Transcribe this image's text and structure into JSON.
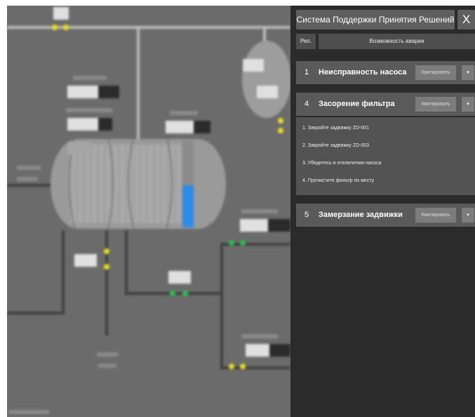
{
  "panel": {
    "title": "Система Поддержки Принятия Решений",
    "close_label": "X",
    "col_rel": "Рел.",
    "col_possibility": "Возможность аварии"
  },
  "alarms": [
    {
      "num": "1",
      "title": "Неисправность насоса",
      "ack_label": "Квитировать",
      "expanded": false
    },
    {
      "num": "4",
      "title": "Засорение фильтра",
      "ack_label": "Квитировать",
      "expanded": true,
      "steps": [
        "1. Закройте задвижку ZD-001",
        "2. Закройте задвижку ZD-003",
        "3. Убедитесь в отключении насоса",
        "4. Прочистите фильтр по месту"
      ]
    },
    {
      "num": "5",
      "title": "Замерзание задвижки",
      "ack_label": "Квитировать",
      "expanded": false
    }
  ],
  "dropdown_icon": "▾",
  "background": {
    "tank_level_fraction": 0.48,
    "level_color": "#2f8be8",
    "valve_colors": {
      "warning": "#e8df1a",
      "open": "#27c24c"
    }
  }
}
